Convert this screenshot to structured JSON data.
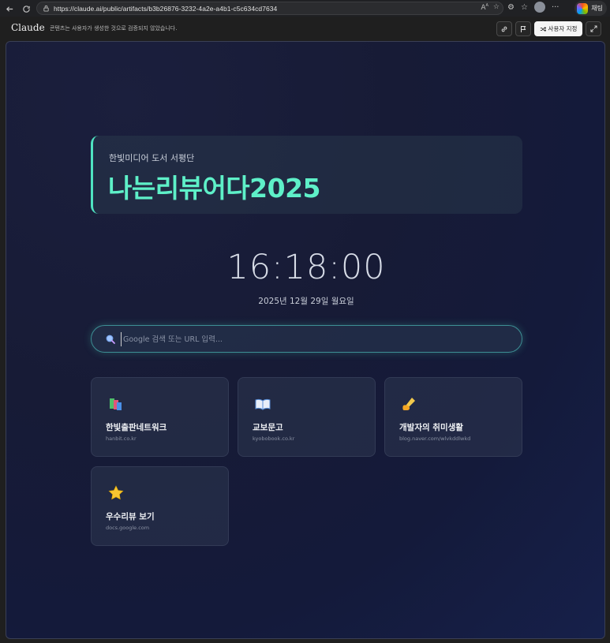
{
  "browser": {
    "url": "https://claude.ai/public/artifacts/b3b26876-3232-4a2e-a4b1-c5c634cd7634",
    "copilot_label": "채팅",
    "more_label": "···"
  },
  "claude": {
    "logo": "Claude",
    "notice": "콘텐츠는 사용자가 생성한 것으로 검증되지 않았습니다.",
    "customize_label": "사용자 지정"
  },
  "hero": {
    "subtitle": "한빛미디어 도서 서평단",
    "title": "나는리뷰어다2025",
    "accent_color": "#4fe3c1"
  },
  "clock": {
    "time": "16:18:00",
    "date": "2025년 12월 29일 월요일"
  },
  "search": {
    "placeholder": "Google 검색 또는 URL 입력...",
    "value": ""
  },
  "shortcuts": [
    {
      "title": "한빛출판네트워크",
      "url": "hanbit.co.kr",
      "icon": "books-icon"
    },
    {
      "title": "교보문고",
      "url": "kyobobook.co.kr",
      "icon": "open-book-icon"
    },
    {
      "title": "개발자의 취미생활",
      "url": "blog.naver.com/wlvkddlwkd",
      "icon": "writing-hand-icon"
    },
    {
      "title": "우수리뷰 보기",
      "url": "docs.google.com",
      "icon": "star-icon"
    }
  ]
}
